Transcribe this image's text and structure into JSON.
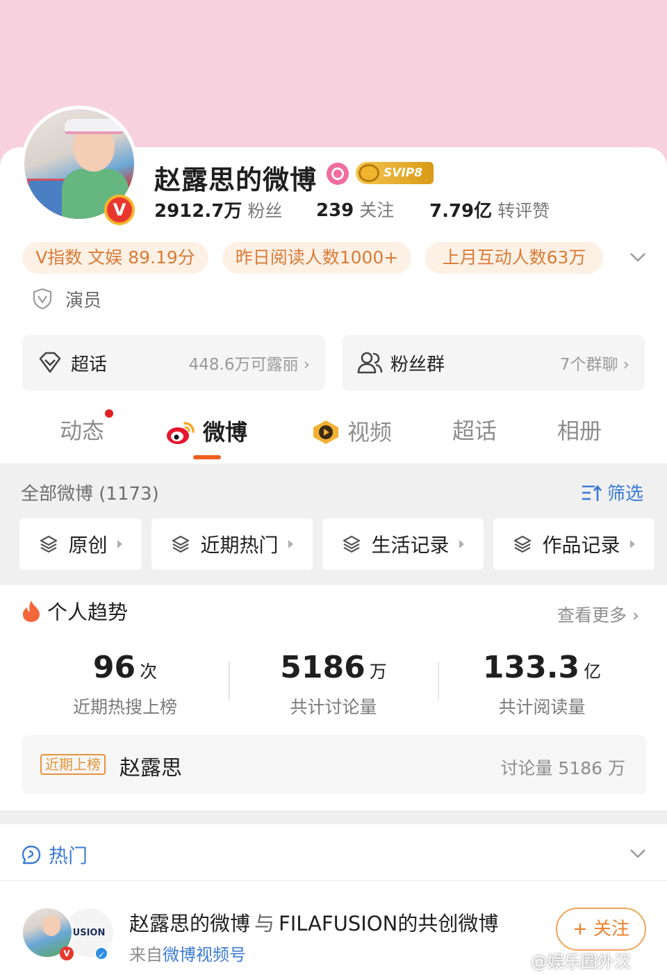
{
  "profile": {
    "name": "赵露思的微博",
    "svip_label": "SVIP8",
    "verified_label": "V",
    "fans_value": "2912.7万",
    "fans_label": "粉丝",
    "following_value": "239",
    "following_label": "关注",
    "interactions_value": "7.79亿",
    "interactions_label": "转评赞"
  },
  "chips": [
    {
      "text": "V指数 文娱 89.19分"
    },
    {
      "text": "昨日阅读人数1000+"
    },
    {
      "text": "上月互动人数63万"
    }
  ],
  "role": "演员",
  "entries": {
    "supertopic": {
      "label": "超话",
      "detail": "448.6万可露丽 ›"
    },
    "fan_group": {
      "label": "粉丝群",
      "detail": "7个群聊 ›"
    }
  },
  "tabs": [
    "动态",
    "微博",
    "视频",
    "超话",
    "相册"
  ],
  "feed": {
    "all_label": "全部微博 (1173)",
    "filter_label": "筛选",
    "categories": [
      "原创",
      "近期热门",
      "生活记录",
      "作品记录"
    ]
  },
  "trend": {
    "title": "个人趋势",
    "more": "查看更多 ›",
    "metrics": [
      {
        "value": "96",
        "unit": "次",
        "label": "近期热搜上榜"
      },
      {
        "value": "5186",
        "unit": "万",
        "label": "共计讨论量"
      },
      {
        "value": "133.3",
        "unit": "亿",
        "label": "共计阅读量"
      }
    ],
    "hot_item": {
      "badge": "近期上榜",
      "name": "赵露思",
      "discussion": "讨论量 5186 万"
    }
  },
  "hot_section": {
    "title": "热门"
  },
  "post": {
    "author": "赵露思的微博",
    "joiner": "与",
    "partner": "FILAFUSION",
    "suffix": "的共创微博",
    "source_prefix": "来自",
    "source_link": "微博视频号",
    "follow_label": "+ 关注",
    "partner_logo_text": "USION"
  },
  "watermark": "@娱乐圈外汉",
  "colors": {
    "cover": "#f8d1de",
    "accent": "#f25f1b",
    "link": "#3a7bd5",
    "chip_text": "#d97b36"
  }
}
